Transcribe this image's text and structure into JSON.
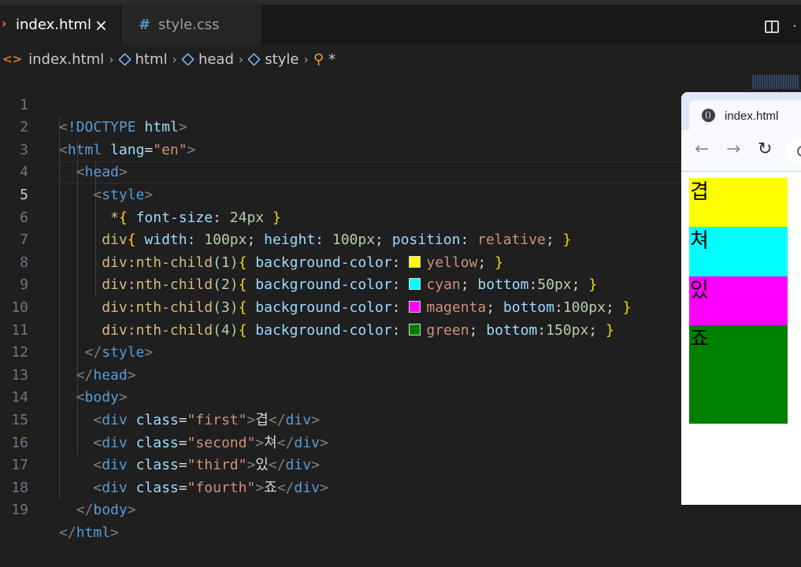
{
  "tabs": [
    {
      "label": "index.html",
      "active": true,
      "close": "×"
    },
    {
      "label": "style.css",
      "active": false
    }
  ],
  "breadcrumb": {
    "items": [
      "index.html",
      "html",
      "head",
      "style",
      "*"
    ]
  },
  "editor": {
    "current_line": 5,
    "line_numbers": [
      "1",
      "2",
      "3",
      "4",
      "5",
      "6",
      "7",
      "8",
      "9",
      "10",
      "11",
      "12",
      "13",
      "14",
      "15",
      "16",
      "17",
      "18",
      "19"
    ],
    "code": {
      "l1": {
        "lt": "<",
        "doctype": "!DOCTYPE",
        "html": "html",
        "gt": ">"
      },
      "l2": {
        "lt": "<",
        "tag": "html",
        "attr": "lang",
        "eq": "=",
        "val": "\"en\"",
        "gt": ">"
      },
      "l3": {
        "lt": "<",
        "tag": "head",
        "gt": ">"
      },
      "l4": {
        "lt": "<",
        "tag": "style",
        "gt": ">"
      },
      "l5": {
        "sel": "*",
        "ob": "{",
        "prop": "font-size",
        "colon": ":",
        "num": "24px",
        "cb": "}"
      },
      "l6": {
        "sel": "div",
        "ob": "{",
        "p1": "width",
        "v1": "100px",
        "semi": ";",
        "p2": "height",
        "v2": "100px",
        "p3": "position",
        "v3": "relative",
        "cb": "}"
      },
      "l7": {
        "sel": "div:nth-child",
        "arg": "(1)",
        "ob": "{",
        "prop": "background-color",
        "colon": ":",
        "color": "yellow",
        "semi": ";",
        "cb": "}"
      },
      "l8": {
        "sel": "div:nth-child",
        "arg": "(2)",
        "ob": "{",
        "prop": "background-color",
        "colon": ":",
        "color": "cyan",
        "semi": ";",
        "p2": "bottom",
        "v2": "50px",
        "cb": "}"
      },
      "l9": {
        "sel": "div:nth-child",
        "arg": "(3)",
        "ob": "{",
        "prop": "background-color",
        "colon": ":",
        "color": "magenta",
        "semi": ";",
        "p2": "bottom",
        "v2": "100px",
        "cb": "}"
      },
      "l10": {
        "sel": "div:nth-child",
        "arg": "(4)",
        "ob": "{",
        "prop": "background-color",
        "colon": ":",
        "color": "green",
        "semi": ";",
        "p2": "bottom",
        "v2": "150px",
        "cb": "}"
      },
      "l11": {
        "lt": "</",
        "tag": "style",
        "gt": ">"
      },
      "l12": {
        "lt": "</",
        "tag": "head",
        "gt": ">"
      },
      "l13": {
        "lt": "<",
        "tag": "body",
        "gt": ">"
      },
      "l14": {
        "lt": "<",
        "tag": "div",
        "attr": "class",
        "eq": "=",
        "val": "\"first\"",
        "gt": ">",
        "text": "겹",
        "clt": "</",
        "ctag": "div",
        "cgt": ">"
      },
      "l15": {
        "lt": "<",
        "tag": "div",
        "attr": "class",
        "eq": "=",
        "val": "\"second\"",
        "gt": ">",
        "text": "쳐",
        "clt": "</",
        "ctag": "div",
        "cgt": ">"
      },
      "l16": {
        "lt": "<",
        "tag": "div",
        "attr": "class",
        "eq": "=",
        "val": "\"third\"",
        "gt": ">",
        "text": "있",
        "clt": "</",
        "ctag": "div",
        "cgt": ">"
      },
      "l17": {
        "lt": "<",
        "tag": "div",
        "attr": "class",
        "eq": "=",
        "val": "\"fourth\"",
        "gt": ">",
        "text": "죠",
        "clt": "</",
        "ctag": "div",
        "cgt": ">"
      },
      "l18": {
        "lt": "</",
        "tag": "body",
        "gt": ">"
      },
      "l19": {
        "lt": "</",
        "tag": "html",
        "gt": ">"
      }
    }
  },
  "browser": {
    "tab_title": "index.html",
    "boxes": [
      {
        "text": "겹",
        "color": "#ffff00"
      },
      {
        "text": "쳐",
        "color": "#00ffff"
      },
      {
        "text": "있",
        "color": "#ff00ff"
      },
      {
        "text": "죠",
        "color": "#008000"
      }
    ]
  },
  "colors": {
    "yellow": "#ffff00",
    "cyan": "#00ffff",
    "magenta": "#ff00ff",
    "green": "#008000"
  }
}
